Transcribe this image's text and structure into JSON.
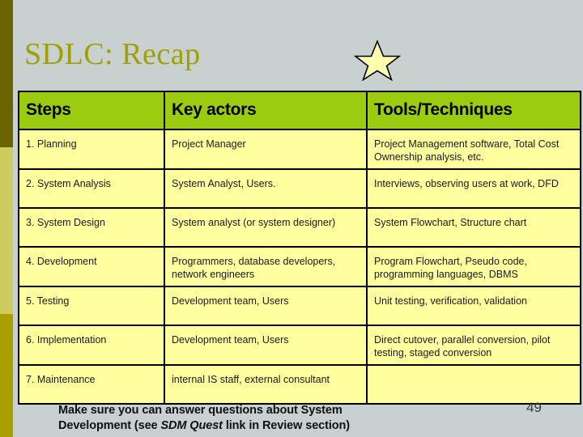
{
  "slide": {
    "title": "SDLC: Recap",
    "page_number": "49",
    "accent_color": "#a0a000",
    "background_color": "#c8d0d0",
    "header_fill": "#9ccc10",
    "cell_fill": "#ffffa0",
    "star_icon": "star-icon",
    "star_fill": "#ffffb0"
  },
  "table": {
    "columns": [
      "Steps",
      "Key actors",
      "Tools/Techniques"
    ],
    "rows": [
      {
        "step": "1. Planning",
        "actors": "Project Manager",
        "tools": "Project Management software, Total Cost Ownership analysis, etc."
      },
      {
        "step": "2. System Analysis",
        "actors": "System Analyst, Users.",
        "tools": "Interviews, observing users at work, DFD"
      },
      {
        "step": "3. System Design",
        "actors": "System analyst (or system designer)",
        "tools": "System Flowchart, Structure chart"
      },
      {
        "step": "4. Development",
        "actors": "Programmers, database developers, network engineers",
        "tools": "Program Flowchart,  Pseudo code, programming languages, DBMS"
      },
      {
        "step": "5. Testing",
        "actors": "Development team, Users",
        "tools": "Unit testing, verification, validation"
      },
      {
        "step": "6. Implementation",
        "actors": "Development team, Users",
        "tools": "Direct cutover, parallel conversion, pilot testing, staged conversion"
      },
      {
        "step": "7. Maintenance",
        "actors": "internal IS staff, external consultant",
        "tools": ""
      }
    ]
  },
  "footer": {
    "line1": "Make sure you can answer questions about System",
    "line2_prefix": "Development  (see ",
    "line2_emphasis": "SDM Quest",
    "line2_suffix": " link in Review section)"
  }
}
